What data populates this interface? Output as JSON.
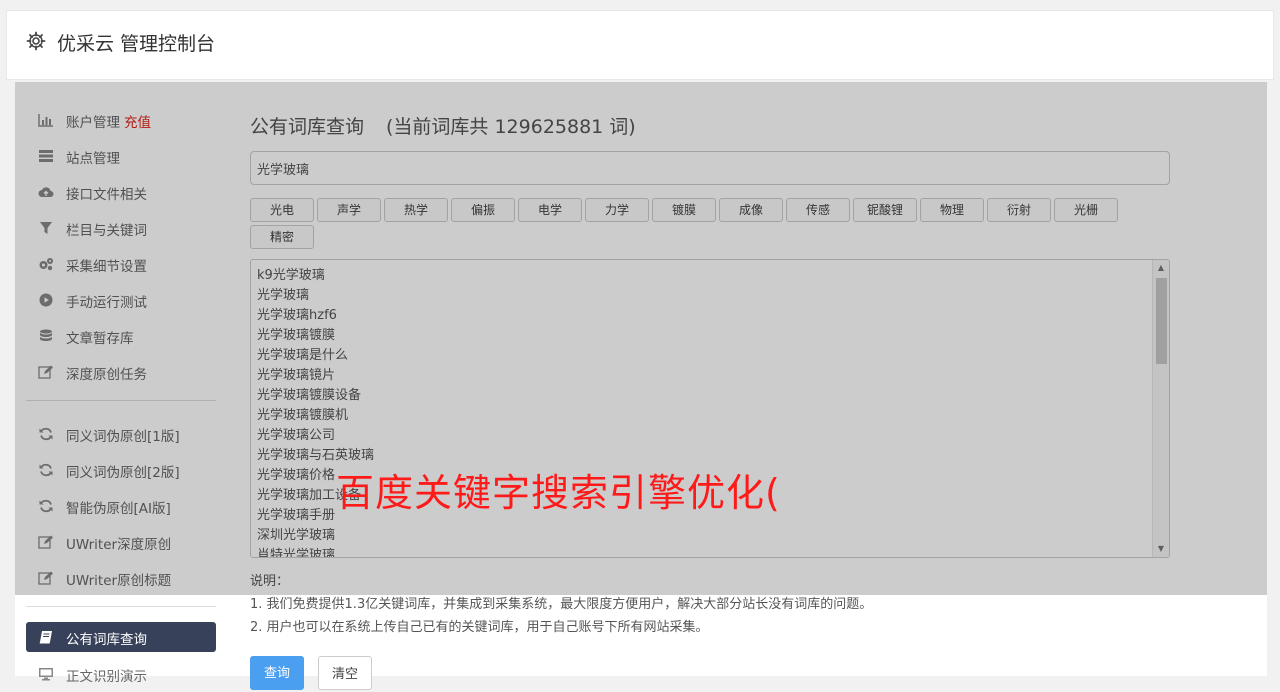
{
  "header": {
    "title": "优采云 管理控制台",
    "icon": "gear-icon"
  },
  "sidebar": {
    "items": [
      {
        "label": "账户管理",
        "badge": "充值",
        "icon": "bar-chart-icon"
      },
      {
        "label": "站点管理",
        "icon": "server-icon"
      },
      {
        "label": "接口文件相关",
        "icon": "cloud-upload-icon"
      },
      {
        "label": "栏目与关键词",
        "icon": "filter-icon"
      },
      {
        "label": "采集细节设置",
        "icon": "gears-icon"
      },
      {
        "label": "手动运行测试",
        "icon": "play-circle-icon"
      },
      {
        "label": "文章暂存库",
        "icon": "database-icon"
      },
      {
        "label": "深度原创任务",
        "icon": "edit-icon"
      }
    ],
    "items2": [
      {
        "label": "同义词伪原创[1版]",
        "icon": "refresh-icon"
      },
      {
        "label": "同义词伪原创[2版]",
        "icon": "refresh-icon"
      },
      {
        "label": "智能伪原创[AI版]",
        "icon": "refresh-icon"
      },
      {
        "label": "UWriter深度原创",
        "icon": "edit-icon"
      },
      {
        "label": "UWriter原创标题",
        "icon": "edit-icon"
      }
    ],
    "items3": [
      {
        "label": "公有词库查询",
        "icon": "book-icon",
        "active": true
      },
      {
        "label": "正文识别演示",
        "icon": "monitor-icon"
      }
    ]
  },
  "main": {
    "title": "公有词库查询",
    "count_text": "(当前词库共 129625881 词)",
    "search_value": "光学玻璃",
    "tags": [
      "光电",
      "声学",
      "热学",
      "偏振",
      "电学",
      "力学",
      "镀膜",
      "成像",
      "传感",
      "铌酸锂",
      "物理",
      "衍射",
      "光栅",
      "精密"
    ],
    "results": [
      "k9光学玻璃",
      "光学玻璃",
      "光学玻璃hzf6",
      "光学玻璃镀膜",
      "光学玻璃是什么",
      "光学玻璃镜片",
      "光学玻璃镀膜设备",
      "光学玻璃镀膜机",
      "光学玻璃公司",
      "光学玻璃与石英玻璃",
      "光学玻璃价格",
      "光学玻璃加工设备",
      "光学玻璃手册",
      "深圳光学玻璃",
      "肖特光学玻璃"
    ],
    "notes": {
      "heading": "说明：",
      "line1": "1. 我们免费提供1.3亿关键词库，并集成到采集系统，最大限度方便用户，解决大部分站长没有词库的问题。",
      "line2": "2. 用户也可以在系统上传自己已有的关键词库，用于自己账号下所有网站采集。"
    },
    "buttons": {
      "query": "查询",
      "clear": "清空"
    }
  },
  "watermark": "百度关键字搜索引擎优化(",
  "colors": {
    "active_bg": "#37425a",
    "primary": "#4a9ff0",
    "badge": "#e2231a",
    "watermark": "#ff1a1a"
  }
}
